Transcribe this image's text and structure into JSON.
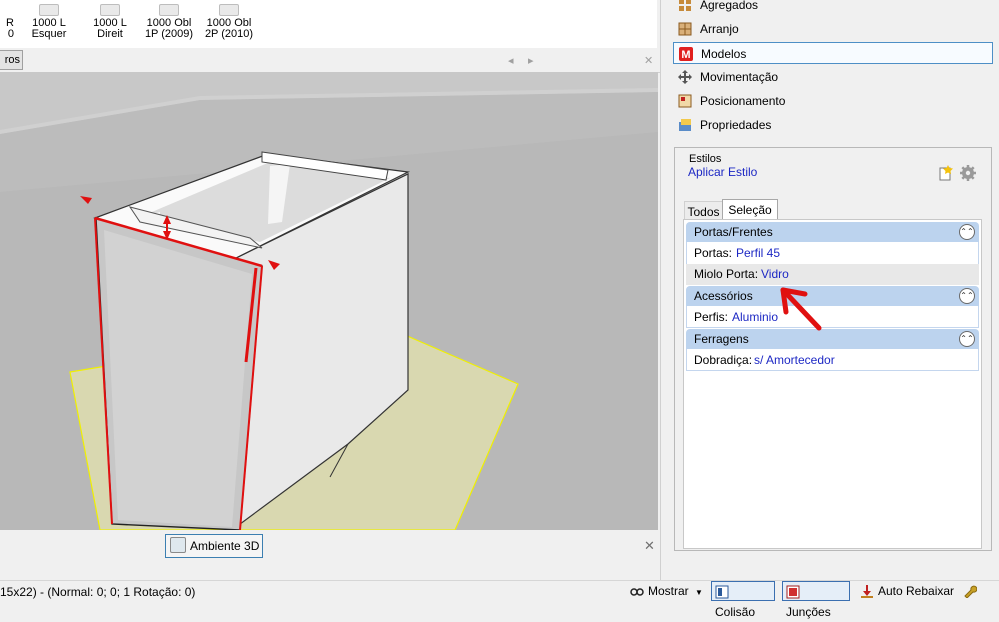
{
  "catalog": {
    "items": [
      {
        "line1": "R",
        "line2": "0"
      },
      {
        "line1": "1000 L",
        "line2": "Esquer"
      },
      {
        "line1": "1000 L",
        "line2": "Direit"
      },
      {
        "line1": "1000 Obl",
        "line2": "1P (2009)"
      },
      {
        "line1": "1000 Obl",
        "line2": "2P (2010)"
      }
    ]
  },
  "top_tabs": {
    "outros_label": "ros",
    "left_chevron": "◂",
    "right_chevron": "▸",
    "close": "✕"
  },
  "doc_tab": {
    "label": "Ambiente 3D",
    "close": "✕"
  },
  "right_menu": [
    {
      "label": "Agregados",
      "icon": "agregados-icon"
    },
    {
      "label": "Arranjo",
      "icon": "arranjo-icon"
    },
    {
      "label": "Modelos",
      "icon": "modelos-icon",
      "selected": true
    },
    {
      "label": "Movimentação",
      "icon": "move-icon"
    },
    {
      "label": "Posicionamento",
      "icon": "position-icon"
    },
    {
      "label": "Propriedades",
      "icon": "properties-icon"
    }
  ],
  "estilos": {
    "title": "Estilos",
    "apply_link": "Aplicar Estilo",
    "tabs": [
      "Todos",
      "Seleção"
    ],
    "active_tab": "Seleção"
  },
  "sections": [
    {
      "title": "Portas/Frentes",
      "rows": [
        {
          "label": "Portas:",
          "value": "Perfil 45"
        },
        {
          "label": "Miolo Porta:",
          "value": "Vidro"
        }
      ]
    },
    {
      "title": "Acessórios",
      "rows": [
        {
          "label": "Perfis:",
          "value": "Aluminio"
        }
      ]
    },
    {
      "title": "Ferragens",
      "rows": [
        {
          "label": "Dobradiça:",
          "value": "s/ Amortecedor"
        }
      ]
    }
  ],
  "status": {
    "text": "15x22) - (Normal: 0; 0; 1 Rotação: 0)",
    "mostrar": "Mostrar",
    "colisao": "Colisão",
    "juncoes": "Junções",
    "auto_rebaixar": "Auto Rebaixar"
  },
  "colors": {
    "link": "#1d28c4",
    "section_header": "#bcd3ee",
    "highlight_red": "#e01010",
    "floor_yellow": "#f0f000"
  }
}
